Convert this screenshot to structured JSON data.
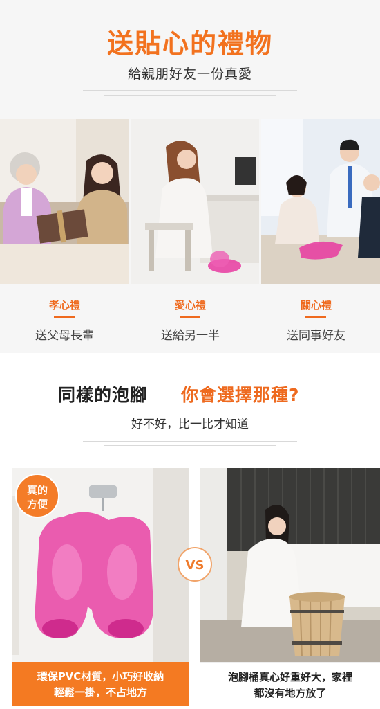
{
  "section1": {
    "title": "送貼心的禮物",
    "subtitle": "給親朋好友一份真愛",
    "cards": [
      {
        "heading": "孝心禮",
        "text": "送父母長輩"
      },
      {
        "heading": "愛心禮",
        "text": "送給另一半"
      },
      {
        "heading": "關心禮",
        "text": "送同事好友"
      }
    ]
  },
  "section2": {
    "title_left": "同樣的泡腳",
    "title_right": "你會選擇那種?",
    "subtitle": "好不好，比一比才知道",
    "badge": [
      "真的",
      "方便"
    ],
    "vs_label": "VS",
    "left_caption": [
      "環保PVC材質，小巧好收納",
      "輕鬆一掛，不占地方"
    ],
    "right_caption": [
      "泡腳桶真心好重好大，家裡",
      "都沒有地方放了"
    ]
  },
  "colors": {
    "accent": "#f47a22",
    "product_pink": "#e83aa0"
  }
}
